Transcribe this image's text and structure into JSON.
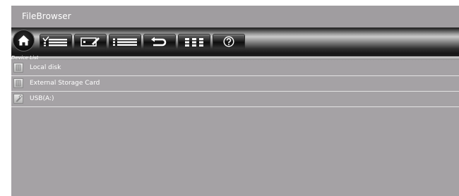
{
  "app": {
    "title": "FileBrowser"
  },
  "toolbar": {
    "buttons": [
      {
        "icon": "home-icon"
      },
      {
        "icon": "select-list-icon"
      },
      {
        "icon": "edit-icon"
      },
      {
        "icon": "list-view-icon"
      },
      {
        "icon": "back-icon"
      },
      {
        "icon": "grid-view-icon"
      },
      {
        "icon": "help-icon"
      }
    ]
  },
  "device_list": {
    "header": "Device List",
    "items": [
      {
        "label": "Local disk",
        "icon": "disk-icon"
      },
      {
        "label": "External Storage Card",
        "icon": "storage-card-icon"
      },
      {
        "label": "USB(A:)",
        "icon": "usb-icon"
      }
    ]
  },
  "colors": {
    "window_bg": "#a5a2a5",
    "text": "#ffffff",
    "toolbar": "#1a1a1a"
  }
}
